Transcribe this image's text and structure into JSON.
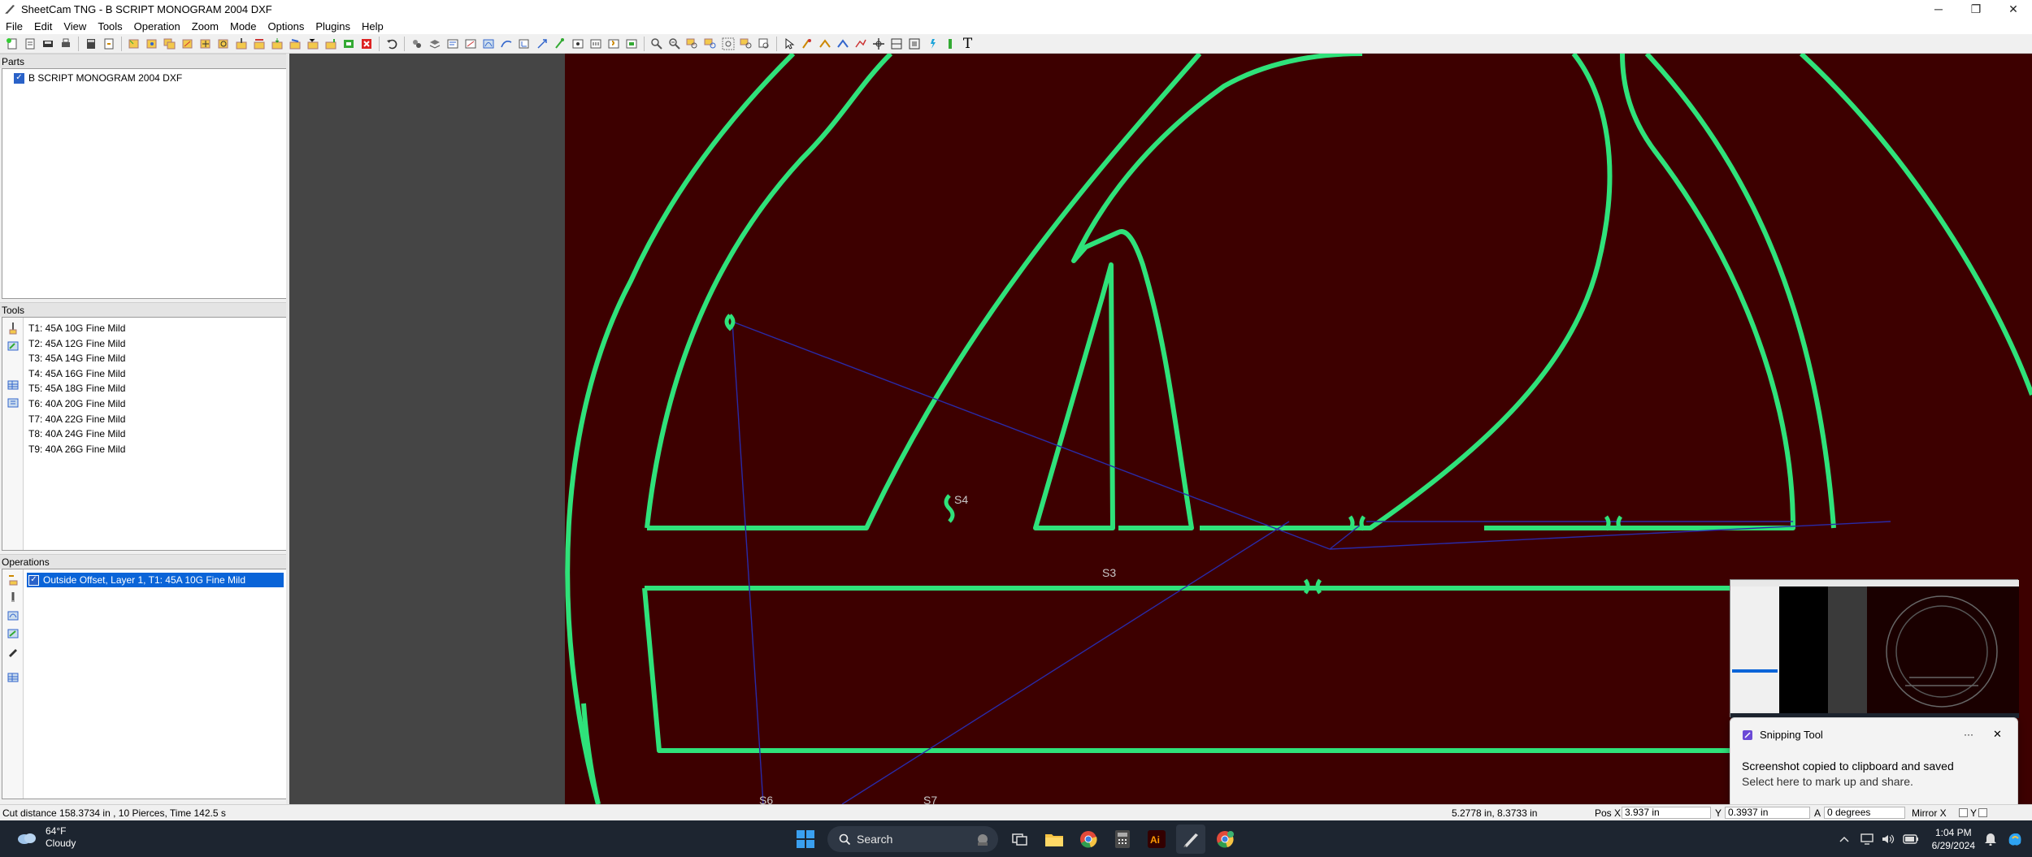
{
  "window": {
    "title": "SheetCam TNG - B SCRIPT MONOGRAM 2004 DXF",
    "minimize": "─",
    "maximize": "❐",
    "close": "✕"
  },
  "menu": [
    "File",
    "Edit",
    "View",
    "Tools",
    "Operation",
    "Zoom",
    "Mode",
    "Options",
    "Plugins",
    "Help"
  ],
  "toolbar_text_tool": "T",
  "panels": {
    "parts": {
      "header": "Parts",
      "items": [
        {
          "label": "B SCRIPT MONOGRAM 2004 DXF",
          "checked": true
        }
      ]
    },
    "tools": {
      "header": "Tools",
      "items": [
        "T1: 45A 10G Fine Mild",
        "T2: 45A 12G Fine Mild",
        "T3: 45A 14G Fine Mild",
        "T4: 45A 16G Fine Mild",
        "T5: 45A 18G Fine Mild",
        "T6: 40A 20G Fine Mild",
        "T7: 40A 22G Fine Mild",
        "T8: 40A 24G Fine Mild",
        "T9: 40A 26G Fine Mild"
      ]
    },
    "operations": {
      "header": "Operations",
      "items": [
        {
          "label": "Outside Offset, Layer 1, T1: 45A 10G Fine Mild",
          "checked": true,
          "selected": true
        }
      ]
    }
  },
  "canvas": {
    "background": "#3d0000",
    "margin_color": "#454545",
    "path_color": "#2fe27a",
    "rapid_color": "#2a2aa8",
    "labels": {
      "s4": "S4",
      "s3": "S3",
      "s6": "S6",
      "s7": "S7"
    }
  },
  "status": {
    "cut_info": "Cut distance 158.3734 in , 10 Pierces, Time 142.5 s",
    "extent": "5.2778 in, 8.3733 in",
    "pos_x_label": "Pos X",
    "pos_x": "3.937 in",
    "y_label": "Y",
    "pos_y": "0.3937 in",
    "a_label": "A",
    "a_value": "0 degrees",
    "mirror_label": "Mirror X",
    "mirror_y_label": "Y"
  },
  "toast": {
    "app": "Snipping Tool",
    "more": "···",
    "close": "✕",
    "title": "Screenshot copied to clipboard and saved",
    "subtitle": "Select here to mark up and share."
  },
  "taskbar": {
    "temperature": "64°F",
    "condition": "Cloudy",
    "search_placeholder": "Search",
    "time": "1:04 PM",
    "date": "6/29/2024"
  }
}
